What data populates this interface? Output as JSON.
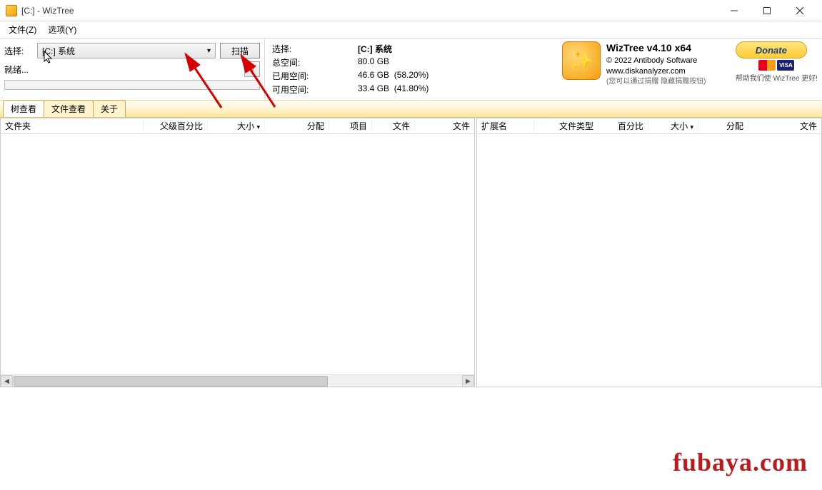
{
  "window": {
    "title": "[C:]  - WizTree"
  },
  "menu": {
    "file": "文件(Z)",
    "options": "选项(Y)"
  },
  "toolbar": {
    "select_label": "选择:",
    "drive_selected": "[C:] 系统",
    "scan_label": "扫描",
    "status_label": "就绪..."
  },
  "info": {
    "select_label": "选择:",
    "select_value": "[C:]  系统",
    "total_label": "总空间:",
    "total_value": "80.0 GB",
    "used_label": "已用空间:",
    "used_value": "46.6 GB",
    "used_pct": "(58.20%)",
    "free_label": "可用空间:",
    "free_value": "33.4 GB",
    "free_pct": "(41.80%)"
  },
  "product": {
    "title": "WizTree v4.10 x64",
    "copyright": "© 2022 Antibody Software",
    "url": "www.diskanalyzer.com",
    "hint": "(您可以通过捐赠 隐藏捐赠按钮)"
  },
  "donate": {
    "button": "Donate",
    "visa": "VISA",
    "subtitle": "帮助我们使 WizTree 更好!"
  },
  "tabs": {
    "tree": "树查看",
    "file": "文件查看",
    "about": "关于"
  },
  "left_cols": {
    "folder": "文件夹",
    "parent_pct": "父级百分比",
    "size": "大小",
    "alloc": "分配",
    "items": "项目",
    "files": "文件",
    "folders": "文件"
  },
  "right_cols": {
    "ext": "扩展名",
    "type": "文件类型",
    "pct": "百分比",
    "size": "大小",
    "alloc": "分配",
    "files": "文件"
  },
  "watermark": "fubaya.com"
}
